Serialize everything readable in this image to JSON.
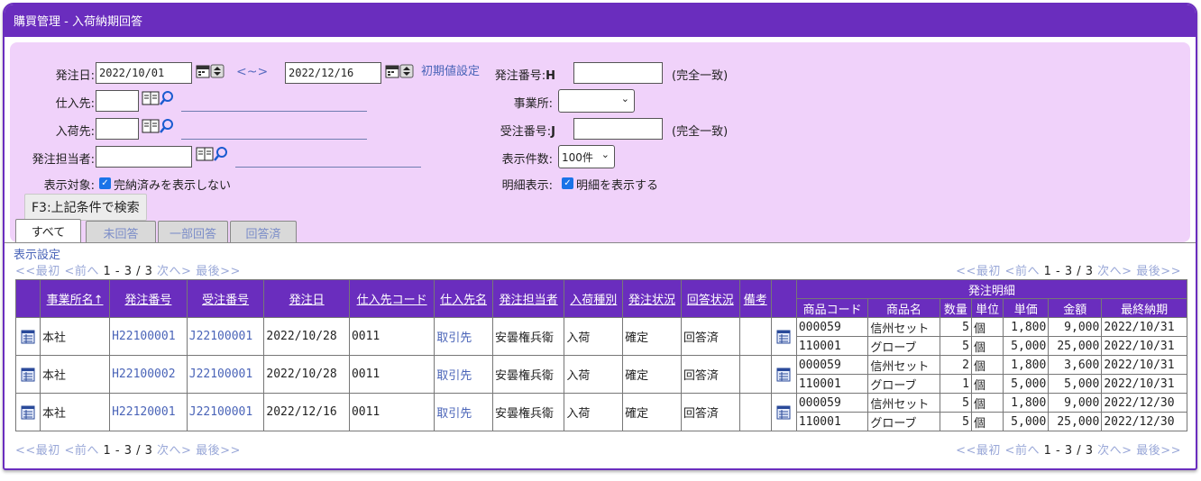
{
  "window": {
    "title": "購買管理 - 入荷納期回答"
  },
  "search": {
    "order_date_label": "発注日:",
    "order_date_from": "2022/10/01",
    "range_sep": "<~>",
    "order_date_to": "2022/12/16",
    "reset_link": "初期値設定",
    "supplier_label": "仕入先:",
    "supplier_value": "",
    "receiver_label": "入荷先:",
    "receiver_value": "",
    "staff_label": "発注担当者:",
    "staff_value": "",
    "target_label": "表示対象:",
    "target_checkbox": "完納済みを表示しない",
    "order_no_label": "発注番号:",
    "order_no_prefix": "H",
    "order_no_value": "",
    "order_no_note": "(完全一致)",
    "office_label": "事業所:",
    "office_value": "",
    "sales_no_label": "受注番号:",
    "sales_no_prefix": "J",
    "sales_no_value": "",
    "sales_no_note": "(完全一致)",
    "count_label": "表示件数:",
    "count_value": "100件",
    "detail_label": "明細表示:",
    "detail_checkbox": "明細を表示する",
    "search_button": "F3:上記条件で検索"
  },
  "tabs": [
    "すべて",
    "未回答",
    "一部回答",
    "回答済"
  ],
  "display_settings": "表示設定",
  "pager": {
    "first": "<<最初",
    "prev": "<前へ",
    "status": "1 - 3 / 3",
    "next": "次へ>",
    "last": "最後>>"
  },
  "table": {
    "columns": [
      "事業所名↑",
      "発注番号",
      "受注番号",
      "発注日",
      "仕入先コード",
      "仕入先名",
      "発注担当者",
      "入荷種別",
      "発注状況",
      "回答状況",
      "備考"
    ],
    "detail_group": "発注明細",
    "detail_columns": [
      "商品コード",
      "商品名",
      "数量",
      "単位",
      "単価",
      "金額",
      "最終納期"
    ],
    "rows": [
      {
        "office": "本社",
        "order_no": "H22100001",
        "sales_no": "J22100001",
        "date": "2022/10/28",
        "supplier_code": "0011",
        "supplier_name": "取引先",
        "staff": "安曇権兵衛",
        "kind": "入荷",
        "status": "確定",
        "answer": "回答済",
        "note": "",
        "details": [
          {
            "code": "000059",
            "name": "信州セット",
            "qty": "5",
            "unit": "個",
            "price": "1,800",
            "amount": "9,000",
            "due": "2022/10/31"
          },
          {
            "code": "110001",
            "name": "グローブ",
            "qty": "5",
            "unit": "個",
            "price": "5,000",
            "amount": "25,000",
            "due": "2022/10/31"
          }
        ]
      },
      {
        "office": "本社",
        "order_no": "H22100002",
        "sales_no": "J22100001",
        "date": "2022/10/28",
        "supplier_code": "0011",
        "supplier_name": "取引先",
        "staff": "安曇権兵衛",
        "kind": "入荷",
        "status": "確定",
        "answer": "回答済",
        "note": "",
        "details": [
          {
            "code": "000059",
            "name": "信州セット",
            "qty": "2",
            "unit": "個",
            "price": "1,800",
            "amount": "3,600",
            "due": "2022/10/31"
          },
          {
            "code": "110001",
            "name": "グローブ",
            "qty": "1",
            "unit": "個",
            "price": "5,000",
            "amount": "5,000",
            "due": "2022/10/31"
          }
        ]
      },
      {
        "office": "本社",
        "order_no": "H22120001",
        "sales_no": "J22100001",
        "date": "2022/12/16",
        "supplier_code": "0011",
        "supplier_name": "取引先",
        "staff": "安曇権兵衛",
        "kind": "入荷",
        "status": "確定",
        "answer": "回答済",
        "note": "",
        "details": [
          {
            "code": "000059",
            "name": "信州セット",
            "qty": "5",
            "unit": "個",
            "price": "1,800",
            "amount": "9,000",
            "due": "2022/12/30"
          },
          {
            "code": "110001",
            "name": "グローブ",
            "qty": "5",
            "unit": "個",
            "price": "5,000",
            "amount": "25,000",
            "due": "2022/12/30"
          }
        ]
      }
    ]
  },
  "colors": {
    "accent": "#6a2dbe",
    "panel": "#f0d2fa",
    "link": "#4a64b8"
  }
}
